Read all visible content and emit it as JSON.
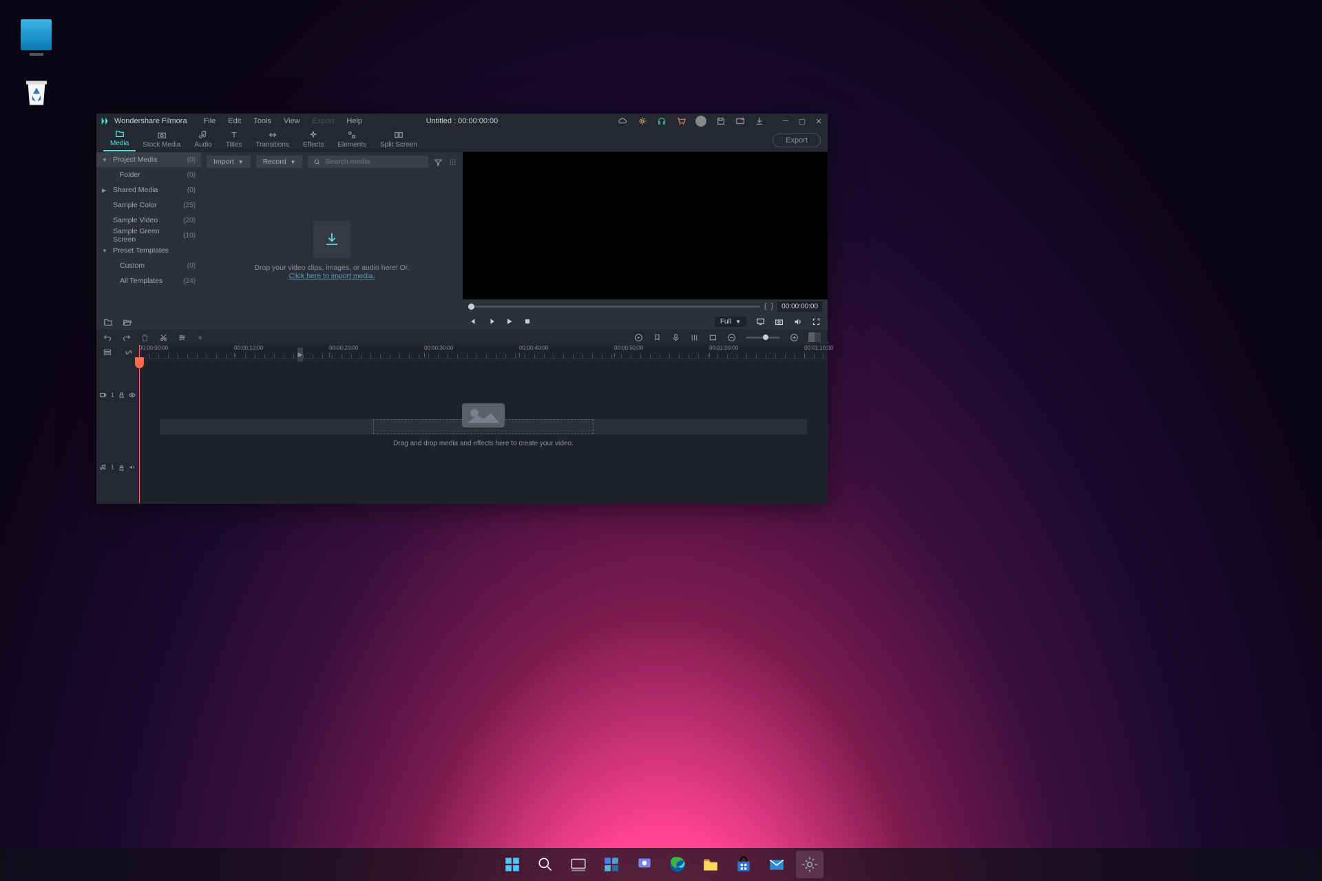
{
  "desktop": {
    "monitor_tooltip": "This PC",
    "recycle_tooltip": "Recycle Bin"
  },
  "app": {
    "name": "Wondershare Filmora",
    "menu": [
      "File",
      "Edit",
      "Tools",
      "View",
      "Export",
      "Help"
    ],
    "menu_disabled_index": 4,
    "title": "Untitled : 00:00:00:00",
    "export_btn": "Export"
  },
  "tabs": [
    {
      "label": "Media",
      "icon": "folder"
    },
    {
      "label": "Stock Media",
      "icon": "camera"
    },
    {
      "label": "Audio",
      "icon": "music"
    },
    {
      "label": "Titles",
      "icon": "text"
    },
    {
      "label": "Transitions",
      "icon": "transition"
    },
    {
      "label": "Effects",
      "icon": "sparkle"
    },
    {
      "label": "Elements",
      "icon": "elements"
    },
    {
      "label": "Split Screen",
      "icon": "split"
    }
  ],
  "active_tab": 0,
  "sidebar": [
    {
      "label": "Project Media",
      "count": "(0)",
      "indent": 0,
      "arrow": "▼",
      "active": true
    },
    {
      "label": "Folder",
      "count": "(0)",
      "indent": 1,
      "arrow": ""
    },
    {
      "label": "Shared Media",
      "count": "(0)",
      "indent": 0,
      "arrow": "▶"
    },
    {
      "label": "Sample Color",
      "count": "(25)",
      "indent": 0,
      "arrow": ""
    },
    {
      "label": "Sample Video",
      "count": "(20)",
      "indent": 0,
      "arrow": ""
    },
    {
      "label": "Sample Green Screen",
      "count": "(10)",
      "indent": 0,
      "arrow": ""
    },
    {
      "label": "Preset Templates",
      "count": "",
      "indent": 0,
      "arrow": "▼"
    },
    {
      "label": "Custom",
      "count": "(0)",
      "indent": 1,
      "arrow": ""
    },
    {
      "label": "All Templates",
      "count": "(24)",
      "indent": 1,
      "arrow": ""
    }
  ],
  "media_toolbar": {
    "import": "Import",
    "record": "Record",
    "search_placeholder": "Search media"
  },
  "media_drop": {
    "text": "Drop your video clips, images, or audio here! Or,",
    "link": "Click here to import media."
  },
  "preview": {
    "time": "00:00:00:00",
    "quality": "Full"
  },
  "ruler": [
    "00:00:00:00",
    "00:00:10:00",
    "00:00:20:00",
    "00:00:30:00",
    "00:00:40:00",
    "00:00:50:00",
    "00:01:00:00",
    "00:01:10:00"
  ],
  "timeline_drop": "Drag and drop media and effects here to create your video.",
  "tracks": [
    {
      "type": "video",
      "num": "1"
    },
    {
      "type": "audio",
      "num": "1"
    }
  ]
}
